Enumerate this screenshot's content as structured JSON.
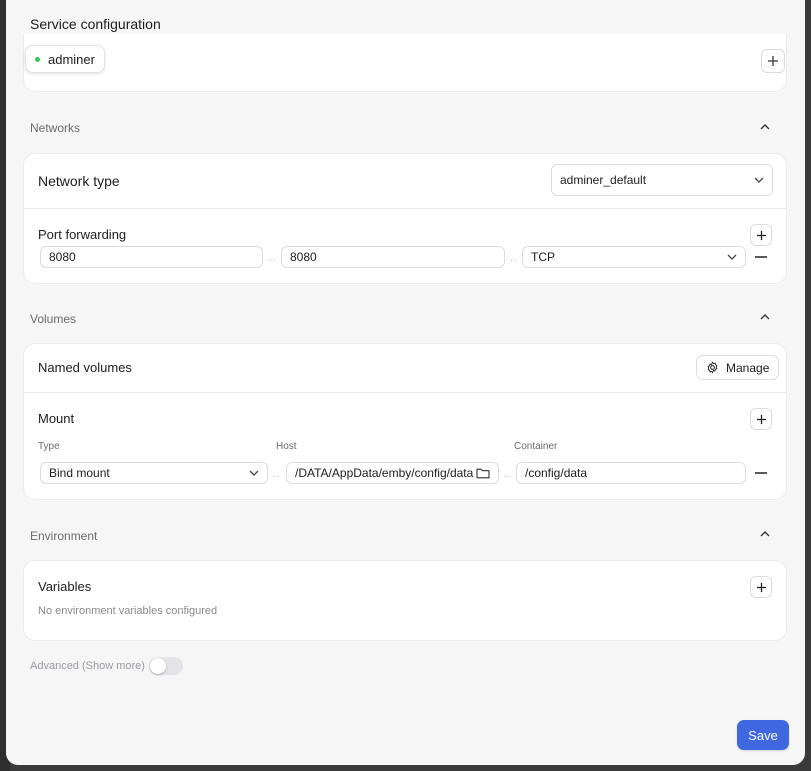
{
  "service_configuration": {
    "title": "Service configuration",
    "services": [
      {
        "name": "adminer",
        "status_color": "#34c759"
      }
    ],
    "add_icon": "plus-icon"
  },
  "networks": {
    "title": "Networks",
    "network_type": {
      "label": "Network type",
      "selected": "adminer_default"
    },
    "port_forwarding": {
      "label": "Port forwarding",
      "rows": [
        {
          "host_port": "8080",
          "container_port": "8080",
          "protocol": "TCP"
        }
      ]
    }
  },
  "volumes": {
    "title": "Volumes",
    "named_volumes": {
      "label": "Named volumes",
      "manage_label": "Manage",
      "manage_icon": "gear-icon"
    },
    "mount": {
      "label": "Mount",
      "columns": {
        "type": "Type",
        "host": "Host",
        "container": "Container"
      },
      "rows": [
        {
          "type": "Bind mount",
          "host": "/DATA/AppData/emby/config/data",
          "container": "/config/data"
        }
      ]
    }
  },
  "environment": {
    "title": "Environment",
    "variables": {
      "label": "Variables",
      "empty_text": "No environment variables configured"
    }
  },
  "advanced": {
    "label": "Advanced (Show more)",
    "enabled": false
  },
  "footer": {
    "save_label": "Save",
    "accent_color": "#3f67e0"
  }
}
